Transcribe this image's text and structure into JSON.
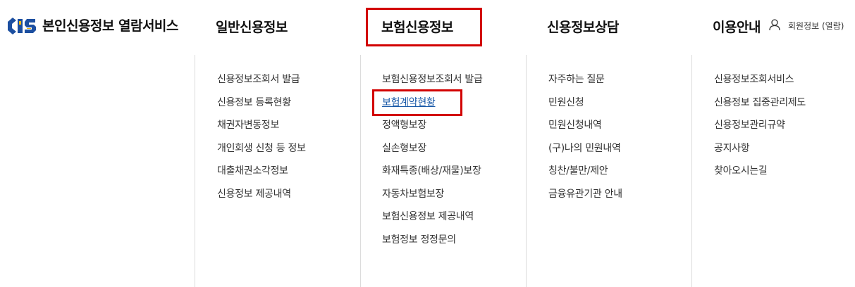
{
  "header": {
    "site_title": "본인신용정보 열람서비스",
    "nav": [
      {
        "label": "일반신용정보"
      },
      {
        "label": "보험신용정보"
      },
      {
        "label": "신용정보상담"
      },
      {
        "label": "이용안내"
      }
    ],
    "member_link": "회원정보 (열람)"
  },
  "menus": [
    {
      "items": [
        "신용정보조회서 발급",
        "신용정보 등록현황",
        "채권자변동정보",
        "개인회생 신청 등 정보",
        "대출채권소각정보",
        "신용정보 제공내역"
      ]
    },
    {
      "items": [
        "보험신용정보조회서 발급",
        "보험계약현황",
        "정액형보장",
        "실손형보장",
        "화재특종(배상/재물)보장",
        "자동차보험보장",
        "보험신용정보 제공내역",
        "보험정보 정정문의"
      ]
    },
    {
      "items": [
        "자주하는 질문",
        "민원신청",
        "민원신청내역",
        "(구)나의 민원내역",
        "칭찬/불만/제안",
        "금융유관기관 안내"
      ]
    },
    {
      "items": [
        "신용정보조회서비스",
        "신용정보 집중관리제도",
        "신용정보관리규약",
        "공지사항",
        "찾아오시는길"
      ]
    }
  ],
  "active": {
    "nav_index": 1,
    "menu_index": 1,
    "item_index": 1
  },
  "colors": {
    "highlight_border": "#d20000",
    "active_link": "#1a5aa8",
    "logo_blue": "#1c4fa0",
    "logo_yellow": "#f5b800"
  },
  "icons": {
    "logo": "kcis-logo-icon",
    "member": "user-icon"
  }
}
